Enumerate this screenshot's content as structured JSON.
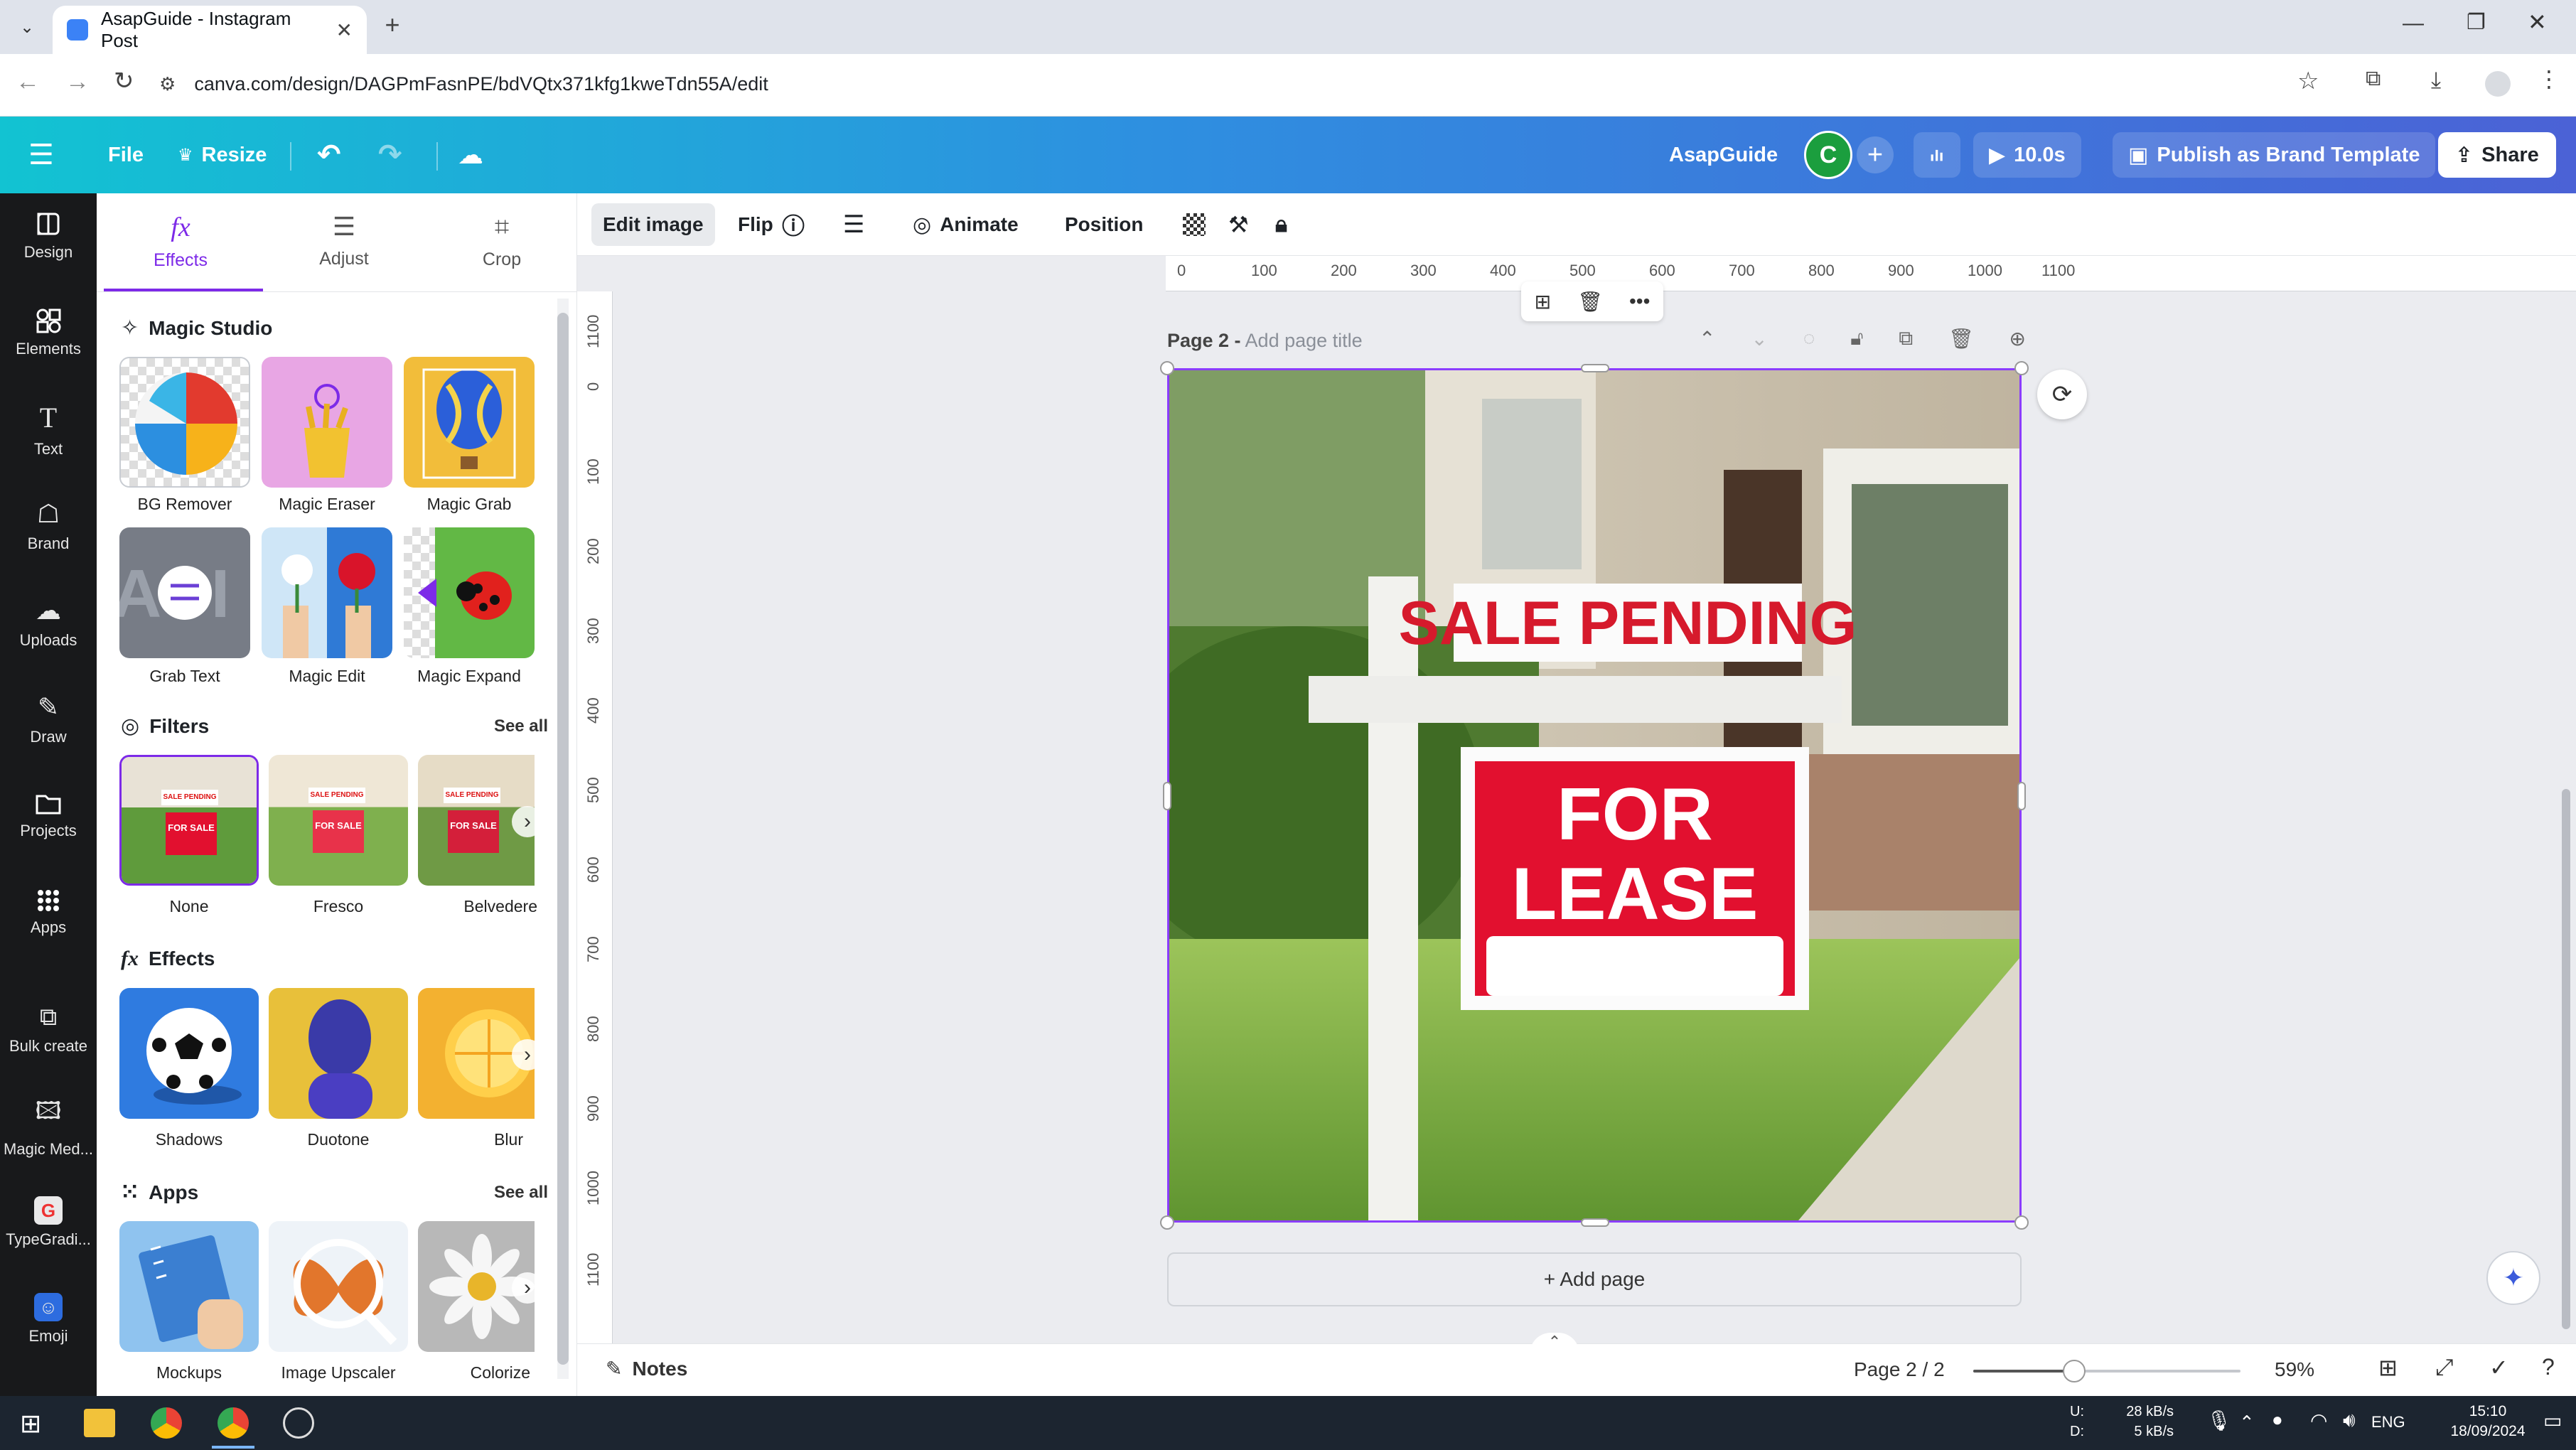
{
  "browser": {
    "tab_title": "AsapGuide - Instagram Post",
    "url": "canva.com/design/DAGPmFasnPE/bdVQtx371kfg1kweTdn55A/edit"
  },
  "header": {
    "file": "File",
    "resize": "Resize",
    "team_name": "AsapGuide",
    "avatar_letter": "C",
    "play_time": "10.0s",
    "publish": "Publish as Brand Template",
    "share": "Share"
  },
  "rail": [
    {
      "label": "Design",
      "icon": "design-icon"
    },
    {
      "label": "Elements",
      "icon": "elements-icon"
    },
    {
      "label": "Text",
      "icon": "text-icon"
    },
    {
      "label": "Brand",
      "icon": "brand-icon"
    },
    {
      "label": "Uploads",
      "icon": "uploads-icon"
    },
    {
      "label": "Draw",
      "icon": "draw-icon"
    },
    {
      "label": "Projects",
      "icon": "projects-icon"
    },
    {
      "label": "Apps",
      "icon": "apps-icon"
    },
    {
      "label": "Bulk create",
      "icon": "bulk-create-icon"
    },
    {
      "label": "Magic Med...",
      "icon": "magic-media-icon"
    },
    {
      "label": "TypeGradi...",
      "icon": "typegradient-icon"
    },
    {
      "label": "Emoji",
      "icon": "emoji-icon"
    }
  ],
  "panel": {
    "tabs": [
      "Effects",
      "Adjust",
      "Crop"
    ],
    "magic_studio_title": "Magic Studio",
    "magic_tools": [
      "BG Remover",
      "Magic Eraser",
      "Magic Grab",
      "Grab Text",
      "Magic Edit",
      "Magic Expand"
    ],
    "filters_title": "Filters",
    "filters": [
      "None",
      "Fresco",
      "Belvedere"
    ],
    "effects_title": "Effects",
    "effects": [
      "Shadows",
      "Duotone",
      "Blur"
    ],
    "apps_title": "Apps",
    "apps": [
      "Mockups",
      "Image Upscaler",
      "Colorize"
    ],
    "see_all": "See all",
    "filter_thumb_text_top": "SALE PENDING",
    "filter_thumb_text_bottom": "FOR SALE"
  },
  "toolbar": {
    "edit_image": "Edit image",
    "flip": "Flip",
    "animate": "Animate",
    "position": "Position"
  },
  "ruler_top": [
    "0",
    "100",
    "200",
    "300",
    "400",
    "500",
    "600",
    "700",
    "800",
    "900",
    "1000",
    "1100"
  ],
  "ruler_left": [
    "1100",
    "0",
    "100",
    "200",
    "300",
    "400",
    "500",
    "600",
    "700",
    "800",
    "900",
    "1000",
    "1100"
  ],
  "page": {
    "label": "Page 2 - ",
    "title_placeholder": "Add page title",
    "sign_top": "SALE PENDING",
    "sign_line1": "FOR",
    "sign_line2": "LEASE",
    "add_page": "+ Add page"
  },
  "status": {
    "notes": "Notes",
    "page_counter": "Page 2 / 2",
    "zoom": "59%",
    "zoom_level": 0.59
  },
  "taskbar": {
    "net_up_label": "U:",
    "net_down_label": "D:",
    "net_up": "28 kB/s",
    "net_down": "5 kB/s",
    "lang": "ENG",
    "time": "15:10",
    "date": "18/09/2024"
  },
  "colors": {
    "brand_gradient_start": "#12c3d2",
    "brand_gradient_end": "#4b62d6",
    "rail_bg": "#18191b",
    "accent_purple": "#8b3dff",
    "sign_red": "#e2102f"
  }
}
